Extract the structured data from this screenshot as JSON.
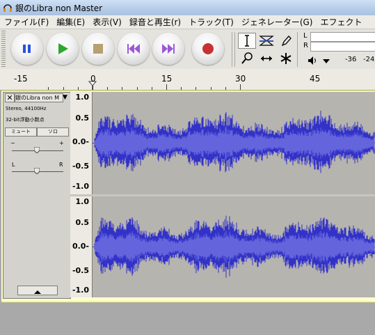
{
  "window": {
    "title": "銀のLibra non Master"
  },
  "menu": {
    "items": [
      "ファイル(F)",
      "編集(E)",
      "表示(V)",
      "録音と再生(r)",
      "トラック(T)",
      "ジェネレーター(G)",
      "エフェクト"
    ]
  },
  "meter": {
    "left_label": "L",
    "right_label": "R",
    "tick_1": "-36",
    "tick_2": "-24"
  },
  "ruler": {
    "labels": [
      "-15",
      "0",
      "15",
      "30",
      "45"
    ]
  },
  "track": {
    "name": "銀のLibra non M",
    "format": "Stereo, 44100Hz",
    "bitdepth": "32-bit浮動小数点",
    "mute_label": "ミュート",
    "solo_label": "ソロ",
    "gain_minus": "−",
    "gain_plus": "+",
    "pan_left": "L",
    "pan_right": "R"
  },
  "amplitude_labels": [
    "1.0",
    "0.5",
    "0.0-",
    "-0.5",
    "-1.0"
  ],
  "colors": {
    "waveform": "#3232c8",
    "waveform_rms": "#6464dc",
    "wave_background": "#b6b4ae",
    "selection_border": "#ffff70"
  }
}
